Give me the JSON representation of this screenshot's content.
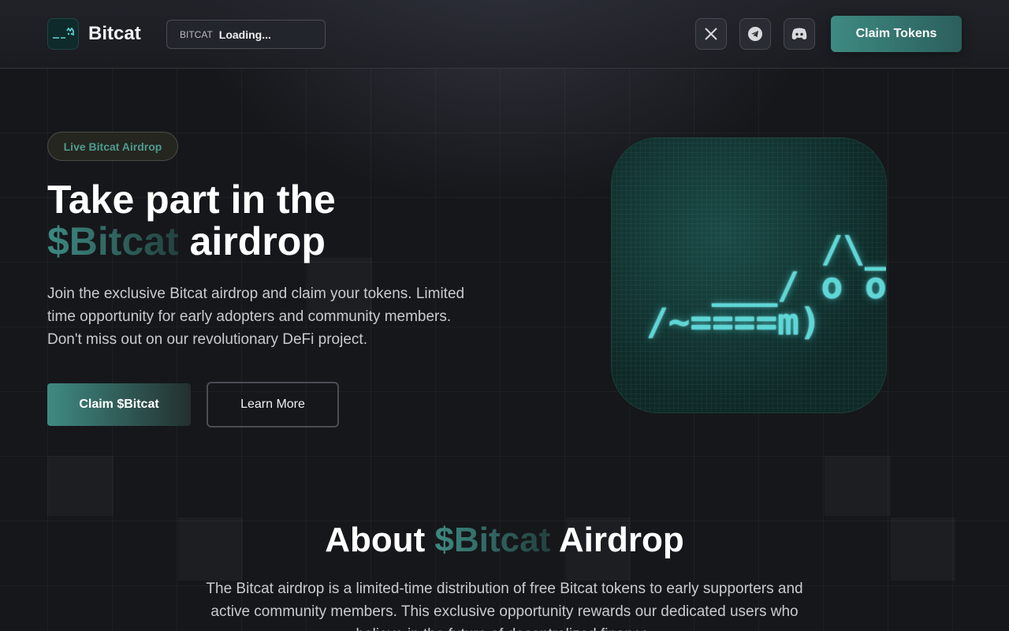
{
  "header": {
    "brand": "Bitcat",
    "ticker_symbol": "BITCAT",
    "ticker_value": "Loading...",
    "claim_button": "Claim Tokens",
    "socials": [
      "x-icon",
      "telegram-icon",
      "discord-icon"
    ]
  },
  "hero": {
    "badge": "Live Bitcat Airdrop",
    "title_line1": "Take part in the",
    "title_accent": "$Bitcat",
    "title_rest": " airdrop",
    "description": " Join the exclusive Bitcat airdrop and claim your tokens. Limited time opportunity for early adopters and community members. Don't miss out on our revolutionary DeFi project.",
    "primary_button": "Claim $Bitcat",
    "secondary_button": "Learn More",
    "cat_art": "        /\\_/\\\n   ___/ o o \\\n/~====m)"
  },
  "about": {
    "title_prefix": "About ",
    "title_accent": "$Bitcat",
    "title_suffix": " Airdrop",
    "description": "The Bitcat airdrop is a limited-time distribution of free Bitcat tokens to early supporters and active community members. This exclusive opportunity rewards our dedicated users who believe in the future of decentralized finance."
  },
  "colors": {
    "accent": "#3e8a82",
    "background": "#16171b",
    "cat_glow": "#5fd6d6"
  }
}
